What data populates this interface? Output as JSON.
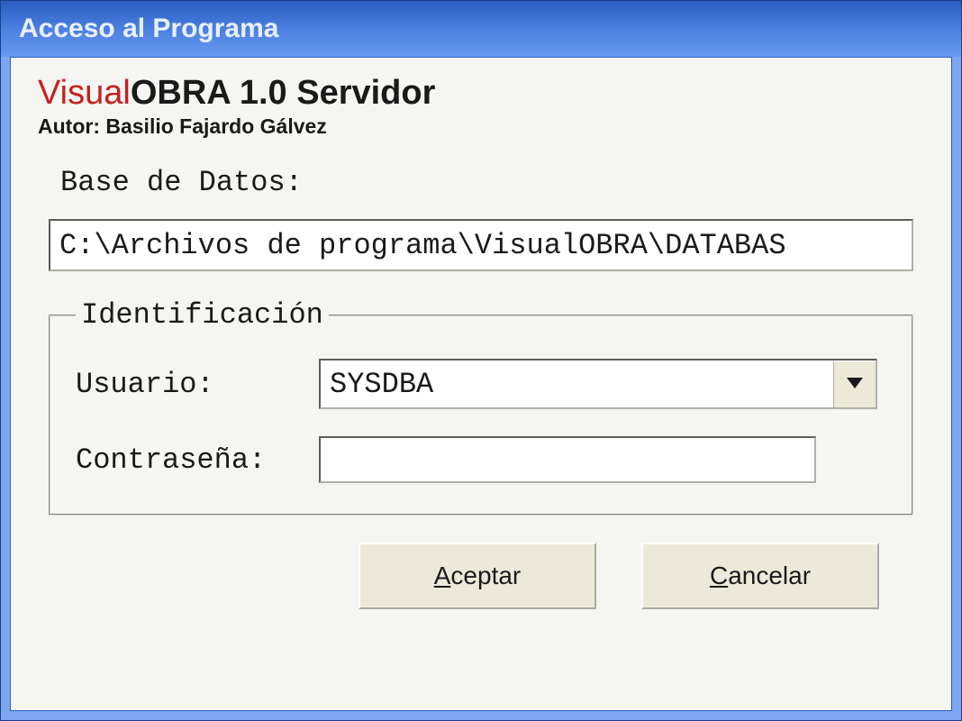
{
  "window": {
    "title": "Acceso al Programa"
  },
  "app": {
    "title_red": "Visual",
    "title_rest": "OBRA 1.0 Servidor",
    "author_label": "Autor: Basilio Fajardo Gálvez"
  },
  "database": {
    "label": "Base de Datos:",
    "value": "C:\\Archivos de programa\\VisualOBRA\\DATABAS"
  },
  "identification": {
    "legend": "Identificación",
    "user_label": "Usuario:",
    "user_value": "SYSDBA",
    "password_label": "Contraseña:",
    "password_value": ""
  },
  "buttons": {
    "accept_mnemonic": "A",
    "accept_rest": "ceptar",
    "cancel_mnemonic": "C",
    "cancel_rest": "ancelar"
  }
}
